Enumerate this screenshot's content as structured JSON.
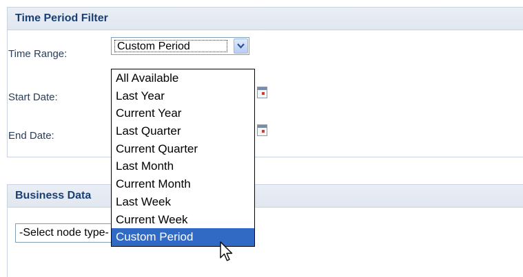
{
  "time_filter": {
    "title": "Time Period Filter",
    "time_range_label": "Time Range:",
    "selected_value": "Custom Period",
    "start_date_label": "Start Date:",
    "end_date_label": "End Date:",
    "options": [
      "All Available",
      "Last Year",
      "Current Year",
      "Last Quarter",
      "Current Quarter",
      "Last Month",
      "Current Month",
      "Last Week",
      "Current Week",
      "Custom Period"
    ],
    "highlighted_option": "Custom Period"
  },
  "business_data": {
    "title": "Business Data",
    "node_select_value": "-Select node type-"
  },
  "icons": {
    "dropdown_arrow": "chevron-down-icon",
    "calendar": "calendar-icon",
    "cursor": "arrow-cursor-icon"
  },
  "colors": {
    "header_text": "#1a3f73",
    "header_bg": "#e4e9f2",
    "selection_bg": "#316ac5"
  }
}
